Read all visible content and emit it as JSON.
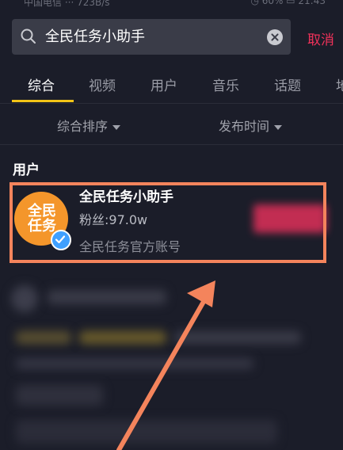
{
  "search": {
    "query": "全民任务小助手",
    "cancel_label": "取消"
  },
  "tabs": [
    {
      "label": "综合"
    },
    {
      "label": "视频"
    },
    {
      "label": "用户"
    },
    {
      "label": "音乐"
    },
    {
      "label": "话题"
    },
    {
      "label": "地"
    }
  ],
  "filters": {
    "sort_label": "综合排序",
    "time_label": "发布时间"
  },
  "section": {
    "title": "用户"
  },
  "user_result": {
    "avatar_text": "全民任务",
    "name": "全民任务小助手",
    "fans": "粉丝:97.0w",
    "description": "全民任务官方账号"
  },
  "colors": {
    "background": "#1b1d29",
    "accent_underline": "#f2c417",
    "cancel": "#f0325a",
    "highlight": "#f4845c",
    "avatar": "#f4962b",
    "verified": "#3fa0ff"
  }
}
